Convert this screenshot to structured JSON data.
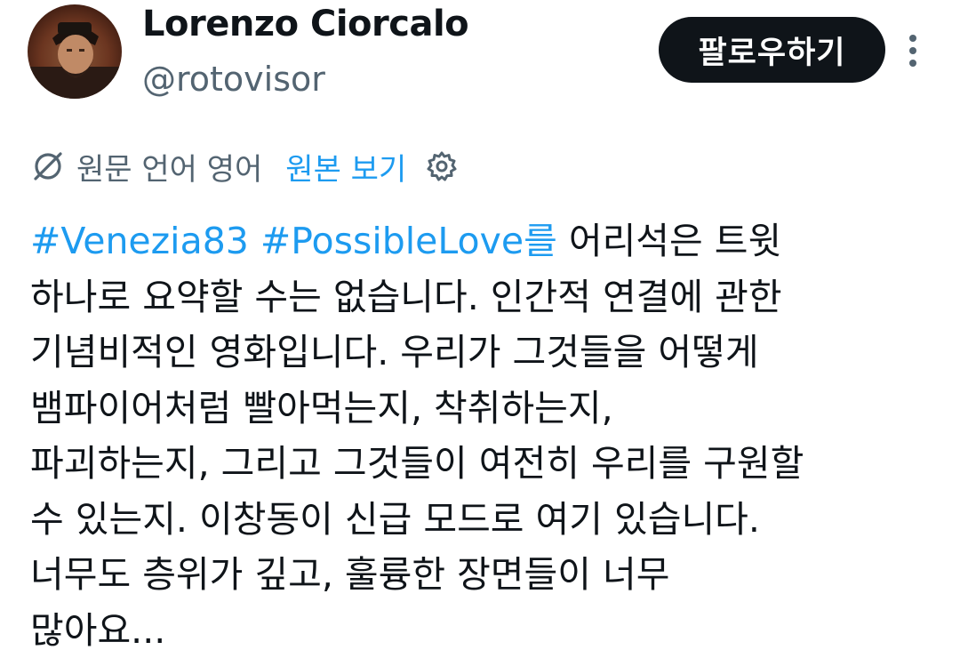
{
  "author": {
    "display_name": "Lorenzo Ciorcalo",
    "handle": "@rotovisor"
  },
  "actions": {
    "follow_label": "팔로우하기",
    "more_icon": "more-vertical-icon"
  },
  "translation": {
    "icon": "translate-icon",
    "source_language": "원문 언어 영어",
    "view_original_label": "원본 보기",
    "settings_icon": "gear-icon"
  },
  "tweet": {
    "hashtag_1": "#Venezia83",
    "hashtag_2": "#PossibleLove",
    "lines": [
      "를 어리석은 트윗",
      "하나로 요약할 수는 없습니다. 인간적 연결에 관한",
      "기념비적인 영화입니다. 우리가 그것들을 어떻게",
      "뱀파이어처럼 빨아먹는지, 착취하는지,",
      "파괴하는지, 그리고 그것들이 여전히 우리를 구원할",
      "수 있는지. 이창동이 신급 모드로 여기 있습니다.",
      "너무도 층위가 깊고, 훌륭한 장면들이 너무",
      "많아요..."
    ]
  },
  "colors": {
    "accent": "#1d9bf0",
    "text": "#0f1419",
    "secondary": "#536471",
    "button_bg": "#0f1419"
  }
}
